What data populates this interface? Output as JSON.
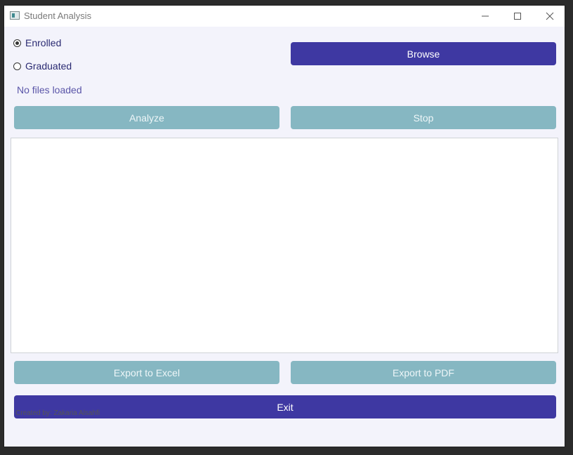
{
  "window": {
    "title": "Student Analysis",
    "icon": "app-window-icon",
    "controls": [
      "minimize-icon",
      "maximize-icon",
      "close-icon"
    ]
  },
  "options": {
    "enrolled_label": "Enrolled",
    "graduated_label": "Graduated",
    "selected": "Enrolled"
  },
  "status": {
    "text": "No files loaded"
  },
  "buttons": {
    "browse": "Browse",
    "analyze": "Analyze",
    "stop": "Stop",
    "export_excel": "Export to Excel",
    "export_pdf": "Export to PDF",
    "exit": "Exit"
  },
  "output": {
    "text": ""
  },
  "footer": {
    "credit": "Created by: Zakaria Alsahfi"
  },
  "colors": {
    "primary": "#3e38a2",
    "disabled": "#86b7c2",
    "background": "#f3f3fb"
  }
}
